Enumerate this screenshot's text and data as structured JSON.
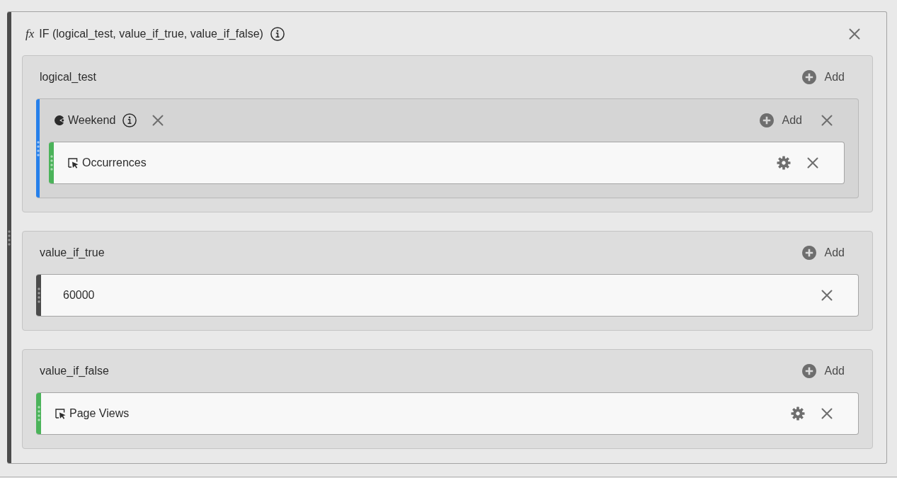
{
  "formula": {
    "symbol": "fx",
    "title": "IF (logical_test, value_if_true, value_if_false)"
  },
  "arguments": [
    {
      "label": "logical_test",
      "add": "Add",
      "items": [
        {
          "kind": "segment",
          "name": "Weekend",
          "add": "Add",
          "children": [
            {
              "kind": "metric",
              "name": "Occurrences"
            }
          ]
        }
      ]
    },
    {
      "label": "value_if_true",
      "add": "Add",
      "items": [
        {
          "kind": "number",
          "name": "60000"
        }
      ]
    },
    {
      "label": "value_if_false",
      "add": "Add",
      "items": [
        {
          "kind": "metric",
          "name": "Page Views"
        }
      ]
    }
  ]
}
